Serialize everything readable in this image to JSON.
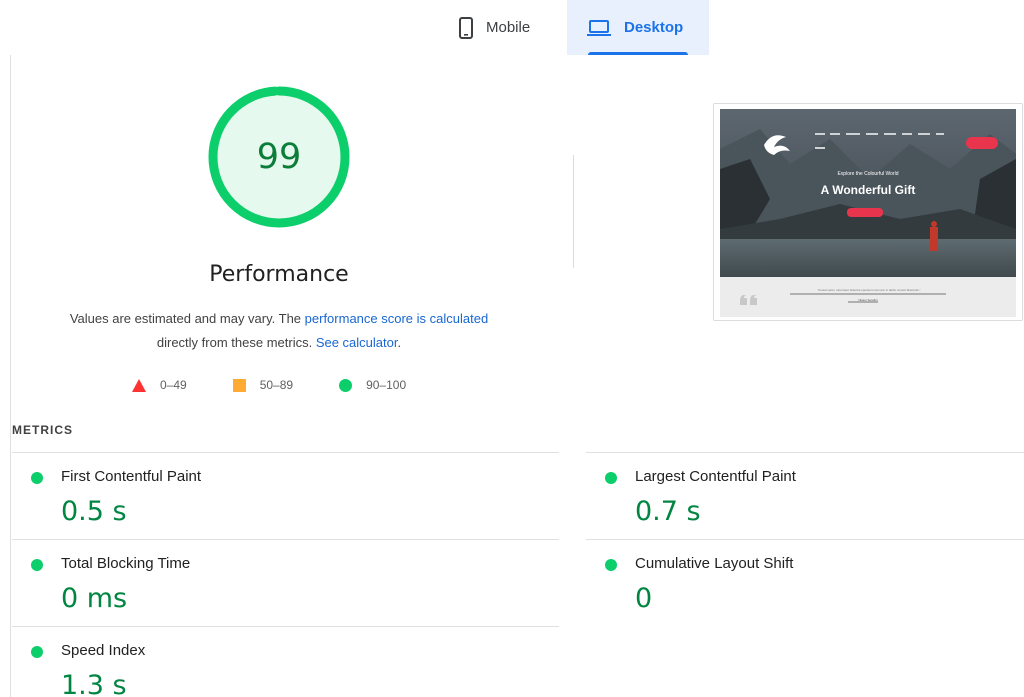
{
  "tabs": {
    "mobile_label": "Mobile",
    "desktop_label": "Desktop",
    "active": "desktop"
  },
  "gauge": {
    "score": "99",
    "score_fraction": 0.99,
    "title": "Performance",
    "color": "#0cce6b"
  },
  "description": {
    "prefix": "Values are estimated and may vary. The ",
    "score_link": "performance score is calculated",
    "middle": " directly from these metrics. ",
    "calc_link": "See calculator",
    "suffix": "."
  },
  "legend": [
    {
      "range": "0–49",
      "shape": "triangle",
      "color": "#ff3333"
    },
    {
      "range": "50–89",
      "shape": "square",
      "color": "#ffaa33"
    },
    {
      "range": "90–100",
      "shape": "circle",
      "color": "#0cce6b"
    }
  ],
  "screenshot": {
    "subtitle": "Explore the Colourful World",
    "headline": "A Wonderful Gift",
    "quote": "“Kuisal vacio, carerraeri federica spectent common in abdiv corami liberantis.”",
    "quote_author": "Nisani Serafini"
  },
  "metrics": {
    "heading": "METRICS",
    "fcp": {
      "label": "First Contentful Paint",
      "value": "0.5 s"
    },
    "lcp": {
      "label": "Largest Contentful Paint",
      "value": "0.7 s"
    },
    "tbt": {
      "label": "Total Blocking Time",
      "value": "0 ms"
    },
    "cls": {
      "label": "Cumulative Layout Shift",
      "value": "0"
    },
    "si": {
      "label": "Speed Index",
      "value": "1.3 s"
    }
  }
}
